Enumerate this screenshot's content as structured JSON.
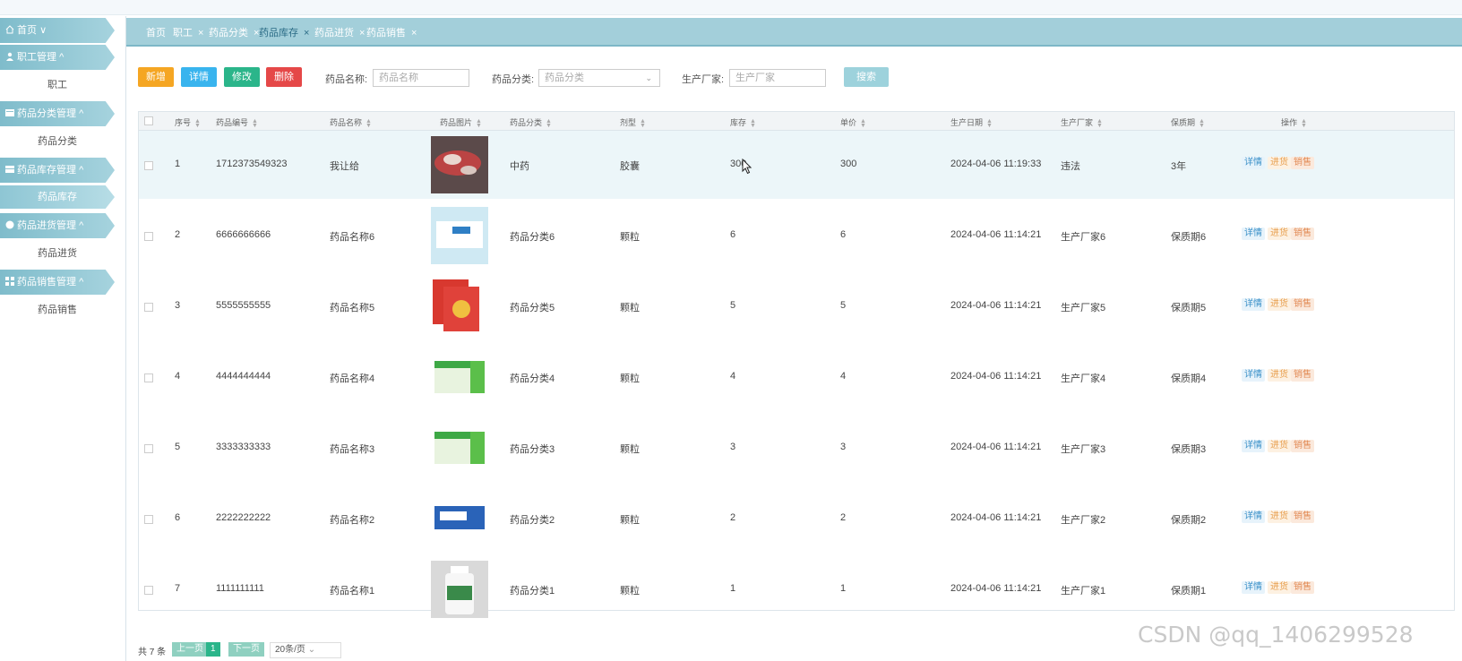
{
  "sidebar": {
    "items": [
      {
        "label": "首页",
        "suffix": "∨"
      },
      {
        "label": "职工管理",
        "suffix": "^"
      },
      {
        "label": "职工"
      },
      {
        "label": "药品分类管理",
        "suffix": "^"
      },
      {
        "label": "药品分类"
      },
      {
        "label": "药品库存管理",
        "suffix": "^"
      },
      {
        "label": "药品库存"
      },
      {
        "label": "药品进货管理",
        "suffix": "^"
      },
      {
        "label": "药品进货"
      },
      {
        "label": "药品销售管理",
        "suffix": "^"
      },
      {
        "label": "药品销售"
      }
    ]
  },
  "tabs": [
    "首页",
    "职工",
    "药品分类",
    "药品库存",
    "药品进货",
    "药品销售"
  ],
  "tab_close": "×",
  "toolbar": {
    "add": "新增",
    "detail": "详情",
    "edit": "修改",
    "delete": "删除",
    "name_label": "药品名称:",
    "name_placeholder": "药品名称",
    "category_label": "药品分类:",
    "category_placeholder": "药品分类",
    "maker_label": "生产厂家:",
    "maker_placeholder": "生产厂家",
    "search": "搜索"
  },
  "table": {
    "headers": [
      "序号",
      "药品编号",
      "药品名称",
      "药品图片",
      "药品分类",
      "剂型",
      "库存",
      "单价",
      "生产日期",
      "生产厂家",
      "保质期",
      "操作"
    ],
    "rows": [
      [
        "1",
        "1712373549323",
        "我让给",
        "中药",
        "胶囊",
        "300",
        "300",
        "2024-04-06 11:19:33",
        "违法",
        "3年"
      ],
      [
        "2",
        "6666666666",
        "药品名称6",
        "药品分类6",
        "颗粒",
        "6",
        "6",
        "2024-04-06 11:14:21",
        "生产厂家6",
        "保质期6"
      ],
      [
        "3",
        "5555555555",
        "药品名称5",
        "药品分类5",
        "颗粒",
        "5",
        "5",
        "2024-04-06 11:14:21",
        "生产厂家5",
        "保质期5"
      ],
      [
        "4",
        "4444444444",
        "药品名称4",
        "药品分类4",
        "颗粒",
        "4",
        "4",
        "2024-04-06 11:14:21",
        "生产厂家4",
        "保质期4"
      ],
      [
        "5",
        "3333333333",
        "药品名称3",
        "药品分类3",
        "颗粒",
        "3",
        "3",
        "2024-04-06 11:14:21",
        "生产厂家3",
        "保质期3"
      ],
      [
        "6",
        "2222222222",
        "药品名称2",
        "药品分类2",
        "颗粒",
        "2",
        "2",
        "2024-04-06 11:14:21",
        "生产厂家2",
        "保质期2"
      ],
      [
        "7",
        "1111111111",
        "药品名称1",
        "药品分类1",
        "颗粒",
        "1",
        "1",
        "2024-04-06 11:14:21",
        "生产厂家1",
        "保质期1"
      ]
    ],
    "actions": [
      "详情",
      "进货",
      "销售"
    ]
  },
  "pagination": {
    "total": "共 7 条",
    "prev": "上一页",
    "page": "1",
    "next": "下一页",
    "size": "20条/页"
  },
  "watermark": "CSDN @qq_1406299528",
  "colors": {
    "add": "#f5a623",
    "detail": "#39b4ee",
    "edit": "#2bb58a",
    "delete": "#e54848",
    "search": "#9dd2dc",
    "accent": "#a3cfda"
  }
}
